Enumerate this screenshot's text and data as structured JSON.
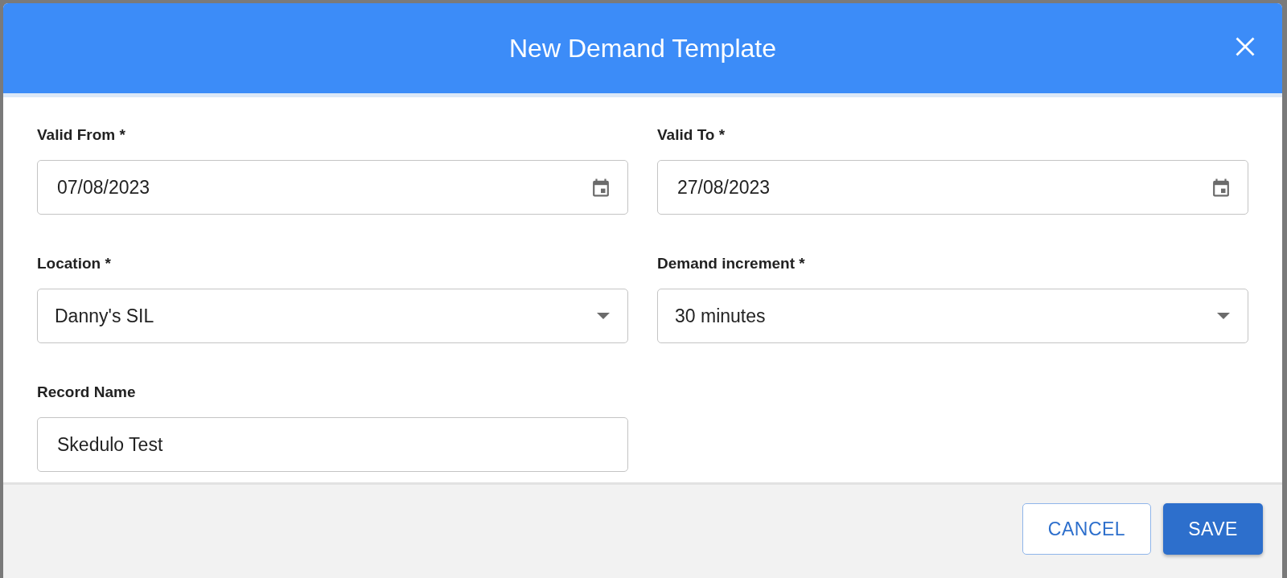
{
  "dialog": {
    "title": "New Demand Template",
    "fields": [
      {
        "label": "Valid From *",
        "value": "07/08/2023",
        "kind": "date"
      },
      {
        "label": "Valid To *",
        "value": "27/08/2023",
        "kind": "date"
      },
      {
        "label": "Location *",
        "value": "Danny's SIL",
        "kind": "select"
      },
      {
        "label": "Demand increment *",
        "value": "30 minutes",
        "kind": "select"
      },
      {
        "label": "Record Name",
        "value": "Skedulo Test",
        "kind": "text"
      }
    ],
    "buttons": [
      {
        "label": "CANCEL",
        "kind": "secondary"
      },
      {
        "label": "SAVE",
        "kind": "primary"
      }
    ]
  }
}
